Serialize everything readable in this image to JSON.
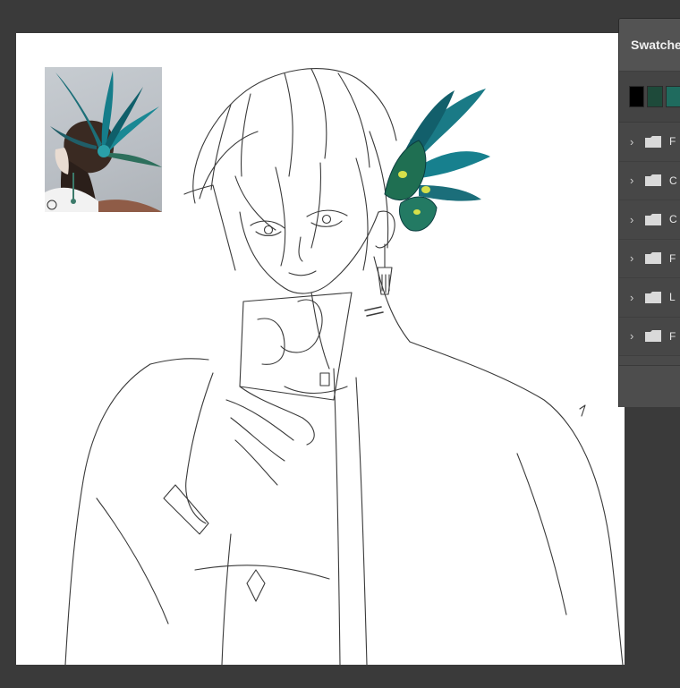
{
  "panel": {
    "title": "Swatche",
    "swatches": [
      {
        "name": "black",
        "color": "#000000"
      },
      {
        "name": "dark-green",
        "color": "#1e4a3a"
      },
      {
        "name": "teal",
        "color": "#1f6b5e"
      }
    ],
    "groups": [
      {
        "label": "F"
      },
      {
        "label": "C"
      },
      {
        "label": "C"
      },
      {
        "label": "F"
      },
      {
        "label": "L"
      },
      {
        "label": "F"
      }
    ]
  },
  "canvas": {
    "background": "#ffffff",
    "accent_feather": "#1a7a86",
    "accent_eye": "#d6e04a"
  }
}
